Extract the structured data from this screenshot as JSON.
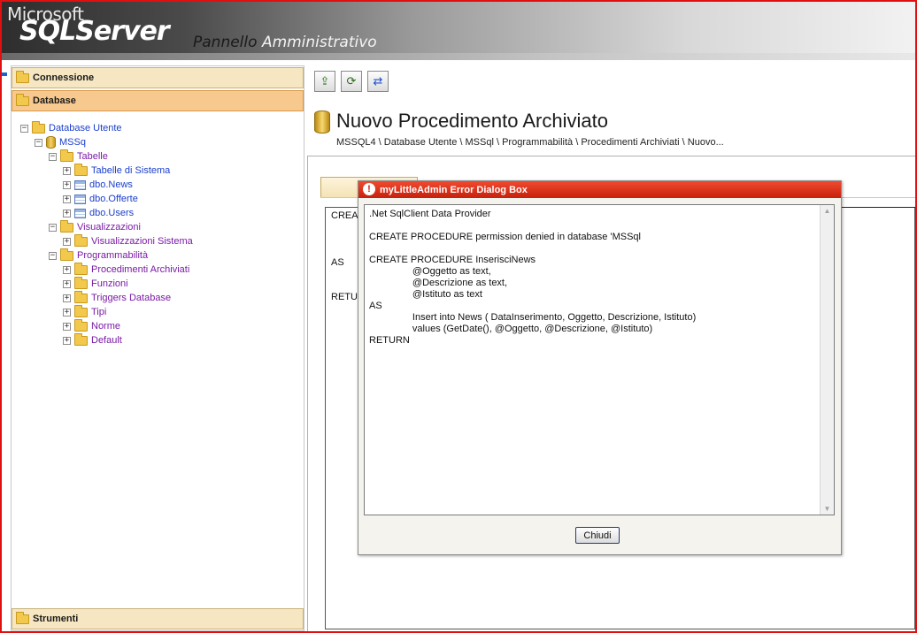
{
  "header": {
    "logo_top": "Microsoft",
    "logo_main": "SQLServer",
    "tagline_a": "Pannello ",
    "tagline_b": "Amministrativo"
  },
  "sidebar": {
    "sections": [
      {
        "label": "Connessione"
      },
      {
        "label": "Database"
      },
      {
        "label": "Strumenti"
      }
    ],
    "tree": [
      {
        "label": "Database Utente",
        "toggle": "⊟",
        "icon": "folder-icon",
        "color": "blue"
      },
      {
        "label": "MSSq",
        "toggle": "⊟",
        "icon": "database-icon",
        "color": "blue"
      },
      {
        "label": "Tabelle",
        "toggle": "⊟",
        "icon": "folder-icon",
        "color": "purple"
      },
      {
        "label": "Tabelle di Sistema",
        "toggle": "⊞",
        "icon": "folder-icon",
        "color": "blue"
      },
      {
        "label": "dbo.News",
        "toggle": "⊞",
        "icon": "table-icon",
        "color": "blue"
      },
      {
        "label": "dbo.Offerte",
        "toggle": "⊞",
        "icon": "table-icon",
        "color": "blue"
      },
      {
        "label": "dbo.Users",
        "toggle": "⊞",
        "icon": "table-icon",
        "color": "blue"
      },
      {
        "label": "Visualizzazioni",
        "toggle": "⊟",
        "icon": "folder-icon",
        "color": "purple"
      },
      {
        "label": "Visualizzazioni Sistema",
        "toggle": "⊞",
        "icon": "folder-icon",
        "color": "purple"
      },
      {
        "label": "Programmabilità",
        "toggle": "⊟",
        "icon": "folder-icon",
        "color": "purple"
      },
      {
        "label": "Procedimenti Archiviati",
        "toggle": "⊞",
        "icon": "folder-icon",
        "color": "purple"
      },
      {
        "label": "Funzioni",
        "toggle": "⊞",
        "icon": "folder-icon",
        "color": "purple"
      },
      {
        "label": "Triggers Database",
        "toggle": "⊞",
        "icon": "folder-icon",
        "color": "purple"
      },
      {
        "label": "Tipi",
        "toggle": "⊞",
        "icon": "folder-icon",
        "color": "purple"
      },
      {
        "label": "Norme",
        "toggle": "⊞",
        "icon": "folder-icon",
        "color": "purple"
      },
      {
        "label": "Default",
        "toggle": "⊞",
        "icon": "folder-icon",
        "color": "purple"
      }
    ]
  },
  "toolbar": {
    "buttons": [
      {
        "icon": "open-icon",
        "glyph": "⇪"
      },
      {
        "icon": "refresh-icon",
        "glyph": "⟳"
      },
      {
        "icon": "swap-icon",
        "glyph": "⇄"
      }
    ]
  },
  "main": {
    "title": "Nuovo Procedimento Archiviato",
    "breadcrumb": "MSSQL4 \\ Database Utente \\ MSSql            \\ Programmabilità \\ Procedimenti Archiviati \\ Nuovo...",
    "editor_lines": [
      "CREAT",
      "AS",
      "RETUR"
    ]
  },
  "dialog": {
    "title": "myLittleAdmin Error Dialog Box",
    "icon": "error-icon",
    "lines": [
      ".Net SqlClient Data Provider",
      "",
      "CREATE PROCEDURE permission denied in database 'MSSql",
      "",
      "CREATE PROCEDURE InserisciNews",
      "                @Oggetto as text,",
      "                @Descrizione as text,",
      "                @Istituto as text",
      "AS",
      "                Insert into News ( DataInserimento, Oggetto, Descrizione, Istituto)",
      "                values (GetDate(), @Oggetto, @Descrizione, @Istituto)",
      "RETURN"
    ],
    "close_label": "Chiudi"
  },
  "colors": {
    "accent_red": "#e01010",
    "section_active": "#f7c98e",
    "tree_blue": "#1a3ecc",
    "tree_purple": "#7a1aa6"
  }
}
